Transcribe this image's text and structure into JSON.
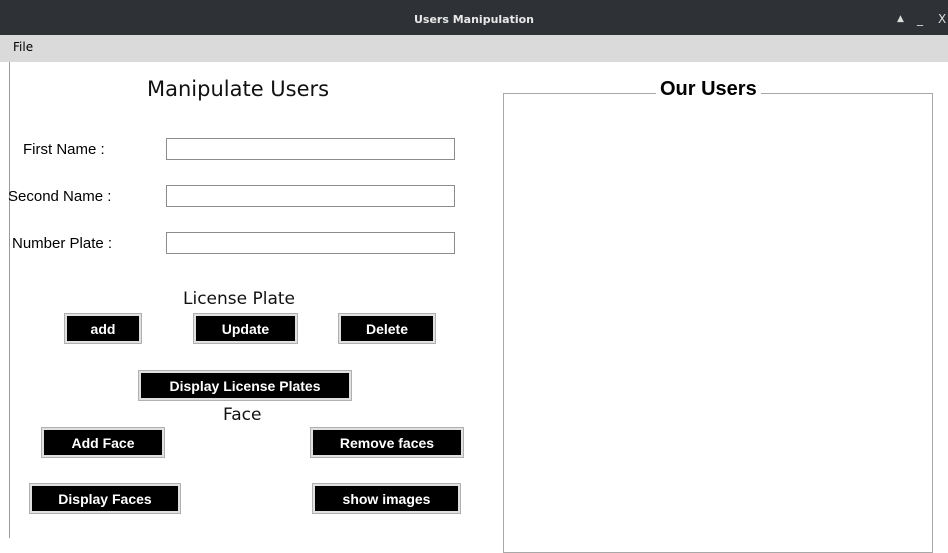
{
  "window": {
    "title": "Users Manipulation",
    "controls": {
      "up": "▲",
      "minimize": "_",
      "close": "X"
    }
  },
  "menu": {
    "file": "File"
  },
  "left": {
    "heading": "Manipulate Users",
    "fields": {
      "first_name_label": "First Name :",
      "first_name_value": "",
      "second_name_label": "Second  Name :",
      "second_name_value": "",
      "number_plate_label": "Number Plate :",
      "number_plate_value": ""
    },
    "license_section": {
      "title": "License Plate",
      "add": "add",
      "update": "Update",
      "delete": "Delete",
      "display": "Display License Plates"
    },
    "face_section": {
      "title": "Face",
      "add_face": "Add  Face",
      "remove_faces": "Remove faces",
      "display_faces": "Display Faces",
      "show_images": "show  images"
    }
  },
  "right": {
    "group_title": "Our Users"
  }
}
